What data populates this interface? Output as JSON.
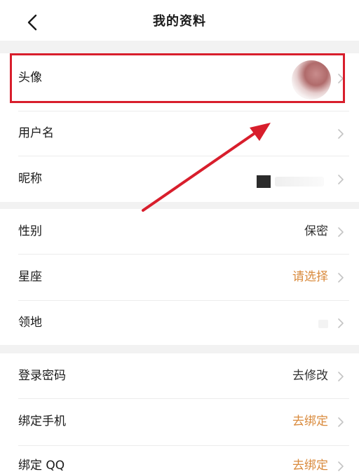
{
  "header": {
    "title": "我的资料"
  },
  "rows": [
    {
      "label": "头像",
      "value": ""
    },
    {
      "label": "用户名",
      "value": ""
    },
    {
      "label": "昵称",
      "value": ""
    },
    {
      "label": "性别",
      "value": "保密"
    },
    {
      "label": "星座",
      "value": "请选择"
    },
    {
      "label": "领地",
      "value": ""
    },
    {
      "label": "登录密码",
      "value": "去修改"
    },
    {
      "label": "绑定手机",
      "value": "去绑定"
    },
    {
      "label": "绑定 QQ",
      "value": "去绑定"
    }
  ],
  "colors": {
    "highlight": "#d81e2c",
    "action_orange": "#d98a3c",
    "section_gap": "#f2f2f2"
  },
  "icons": {
    "back": "chevron-left-icon",
    "row_arrow": "chevron-right-icon"
  }
}
